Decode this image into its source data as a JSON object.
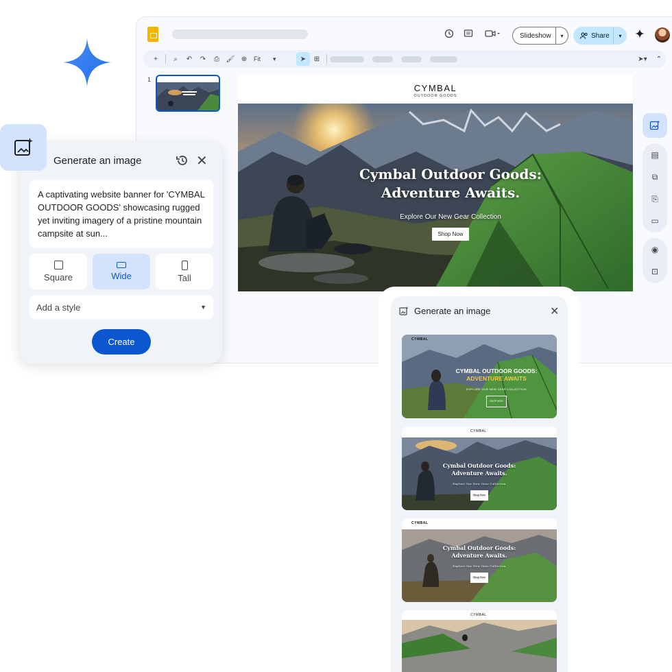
{
  "colors": {
    "accent": "#0b57d0",
    "accent_light": "#d3e3fd",
    "share_bg": "#c2e7ff",
    "slides_yellow": "#f4b400"
  },
  "toolbar": {
    "slideshow_label": "Slideshow",
    "share_label": "Share",
    "zoom_label": "Fit"
  },
  "filmstrip": {
    "slide_number": "1"
  },
  "slide": {
    "brand": "CYMBAL",
    "brand_sub": "OUTDOOR GOODS",
    "headline_line1": "Cymbal Outdoor Goods:",
    "headline_line2": "Adventure Awaits.",
    "subheadline": "Explore Our New Gear Collection",
    "cta": "Shop Now"
  },
  "generate_panel": {
    "title": "Generate an image",
    "prompt": "A captivating website banner for 'CYMBAL OUTDOOR GOODS' showcasing rugged yet inviting imagery of a pristine mountain campsite at sun...",
    "aspect_options": [
      {
        "label": "Square",
        "selected": false
      },
      {
        "label": "Wide",
        "selected": true
      },
      {
        "label": "Tall",
        "selected": false
      }
    ],
    "style_placeholder": "Add a style",
    "create_label": "Create"
  },
  "results_panel": {
    "title": "Generate an image",
    "results": [
      {
        "brand": "CYMBAL",
        "line1": "CYMBAL OUTDOOR GOODS:",
        "line2": "ADVENTURE AWAITS",
        "sub": "EXPLORE OUR NEW GEAR COLLECTION",
        "cta": "SHOP NOW"
      },
      {
        "brand": "CYMBAL",
        "line1": "Cymbal Outdoor Goods:",
        "line2": "Adventure Awaits.",
        "sub": "Explore Our New Gear Collection",
        "cta": "Shop Now"
      },
      {
        "brand": "CYMBAL",
        "line1": "Cymbal Outdoor Goods:",
        "line2": "Adventure Awaits.",
        "sub": "Explore Our New Gear Collection",
        "cta": "Shop Now"
      },
      {
        "brand": "CYMBAL"
      }
    ]
  },
  "icons": [
    "sparkle-icon",
    "history-icon",
    "comment-icon",
    "camera-icon",
    "people-icon",
    "gemini-icon",
    "image-add-icon",
    "close-icon",
    "chevron-down-icon"
  ]
}
